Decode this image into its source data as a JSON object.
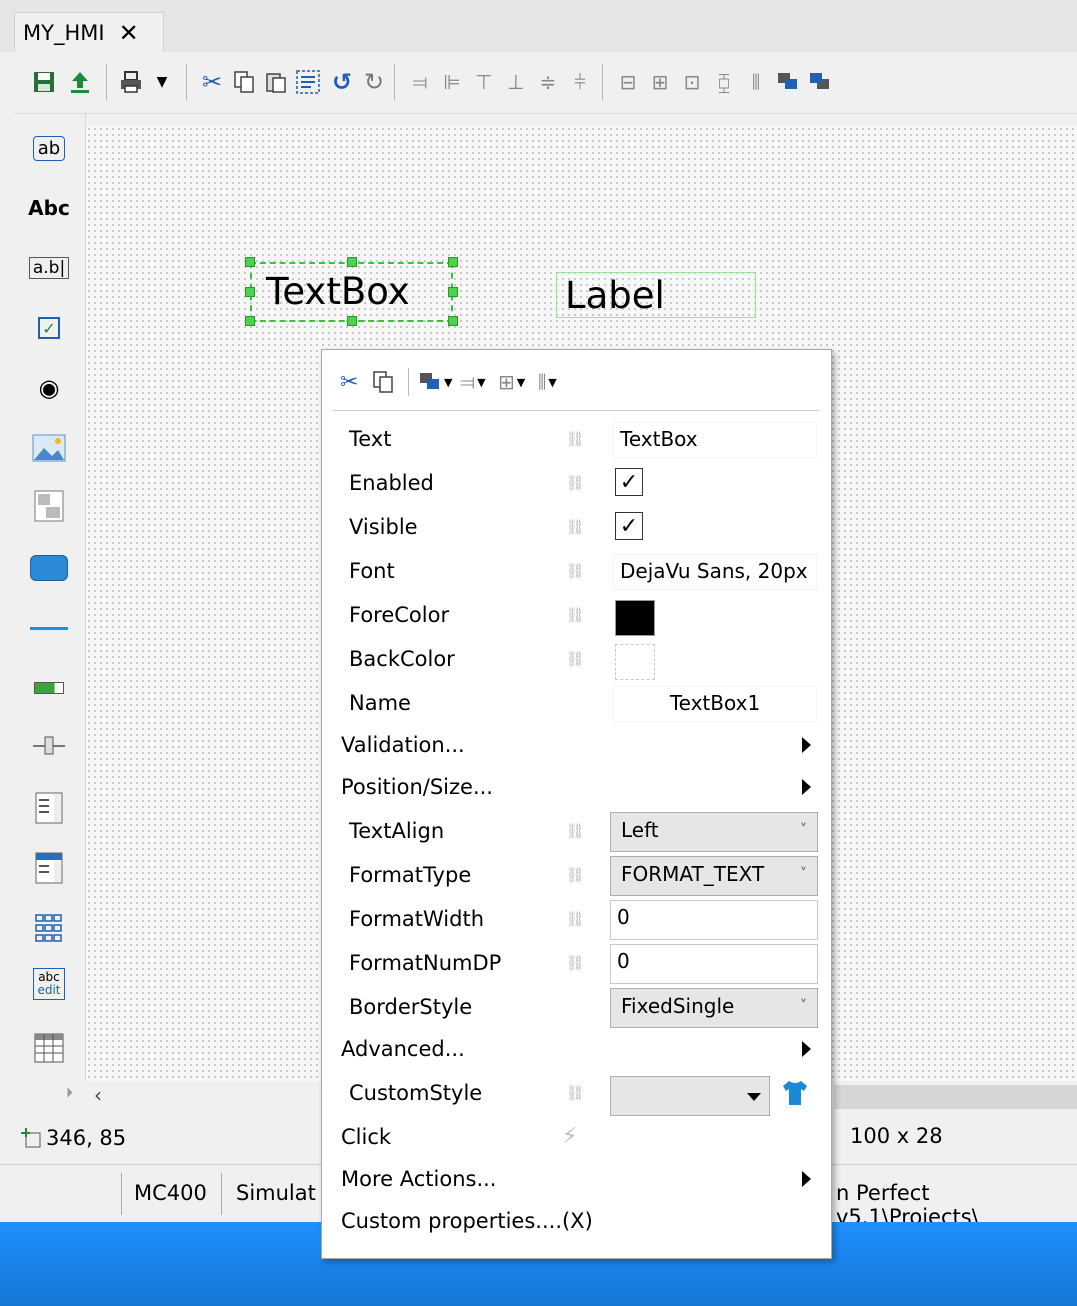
{
  "tab": {
    "title": "MY_HMI",
    "close_glyph": "✕"
  },
  "toolbar": {
    "icons": [
      "save-icon",
      "upload-icon",
      "print-icon",
      "cut-icon",
      "copy-icon",
      "paste-icon",
      "select-all-icon",
      "undo-icon",
      "redo-icon",
      "align-left-icon",
      "align-center-icon",
      "align-top-icon",
      "align-bottom-icon",
      "align-middle-icon",
      "distribute-icon",
      "grid-icon",
      "size-icon",
      "group-icon",
      "center-icon",
      "space-icon",
      "bring-front-icon",
      "send-back-icon"
    ]
  },
  "toolbox": {
    "items": [
      {
        "name": "textbox-tool-icon",
        "glyph": "ab"
      },
      {
        "name": "label-tool-icon",
        "glyph": "Abc"
      },
      {
        "name": "edit-tool-icon",
        "glyph": "a.b|"
      },
      {
        "name": "checkbox-tool-icon",
        "glyph": "☑"
      },
      {
        "name": "radio-tool-icon",
        "glyph": "◉"
      },
      {
        "name": "image-tool-icon",
        "glyph": "🖼"
      },
      {
        "name": "panel-tool-icon",
        "glyph": "▦"
      },
      {
        "name": "button-tool-icon",
        "glyph": "▬"
      },
      {
        "name": "line-tool-icon",
        "glyph": "—"
      },
      {
        "name": "progress-tool-icon",
        "glyph": "▭"
      },
      {
        "name": "slider-tool-icon",
        "glyph": "⊸"
      },
      {
        "name": "listbox-tool-icon",
        "glyph": "≣"
      },
      {
        "name": "combobox-tool-icon",
        "glyph": "▤"
      },
      {
        "name": "keypad-tool-icon",
        "glyph": "▩"
      },
      {
        "name": "abc-edit-tool-icon",
        "glyph": "abc\nedit"
      },
      {
        "name": "grid-tool-icon",
        "glyph": "▦"
      }
    ]
  },
  "canvas": {
    "textbox_text": "TextBox",
    "label_text": "Label"
  },
  "coords": {
    "position": "346, 85",
    "size": "100 x 28"
  },
  "statusbar": {
    "controller": "MC400",
    "mode": "Simulat",
    "path": "n Perfect v5.1\\Projects\\"
  },
  "panel": {
    "properties": {
      "text_label": "Text",
      "text_value": "TextBox",
      "enabled_label": "Enabled",
      "enabled_value": "✓",
      "visible_label": "Visible",
      "visible_value": "✓",
      "font_label": "Font",
      "font_value": "DejaVu Sans, 20px",
      "forecolor_label": "ForeColor",
      "forecolor_value": "#000000",
      "backcolor_label": "BackColor",
      "backcolor_value": "#ffffff",
      "name_label": "Name",
      "name_value": "TextBox1",
      "validation_label": "Validation...",
      "position_label": "Position/Size...",
      "textalign_label": "TextAlign",
      "textalign_value": "Left",
      "formattype_label": "FormatType",
      "formattype_value": "FORMAT_TEXT",
      "formatwidth_label": "FormatWidth",
      "formatwidth_value": "0",
      "formatnumdp_label": "FormatNumDP",
      "formatnumdp_value": "0",
      "borderstyle_label": "BorderStyle",
      "borderstyle_value": "FixedSingle",
      "advanced_label": "Advanced...",
      "customstyle_label": "CustomStyle",
      "click_label": "Click",
      "moreactions_label": "More Actions...",
      "custom_label": "Custom properties....(X)"
    },
    "link_glyph": "⛓",
    "dropdown_glyph": "˅"
  },
  "colors": {
    "selection": "#35c535",
    "taskbar": "#1e90ff",
    "shirt": "#1e88d8"
  }
}
